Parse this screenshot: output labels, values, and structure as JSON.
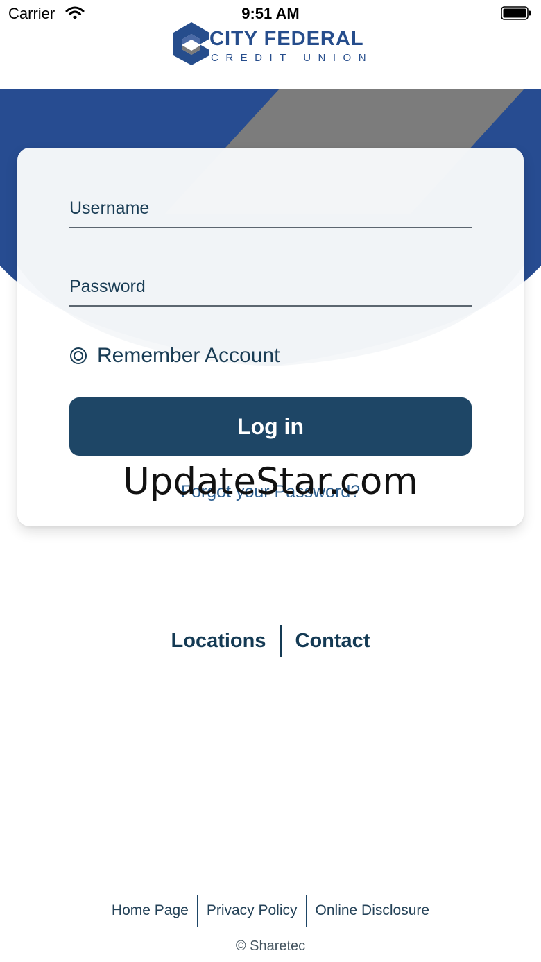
{
  "status_bar": {
    "carrier": "Carrier",
    "time": "9:51 AM",
    "wifi_icon": "wifi-icon",
    "battery_icon": "battery-icon"
  },
  "brand": {
    "name_line1": "CITY FEDERAL",
    "name_line2": "CREDIT UNION",
    "logo_icon": "cfcu-hexagon-logo",
    "colors": {
      "navy": "#264d8c",
      "gray": "#7a7a7a",
      "band_blue": "#274c91",
      "button": "#1e4666"
    }
  },
  "login": {
    "username_placeholder": "Username",
    "password_placeholder": "Password",
    "username_value": "",
    "password_value": "",
    "remember_label": "Remember Account",
    "remember_icon": "radio-unchecked-icon",
    "login_button": "Log in",
    "forgot_password": "Forgot your Password?"
  },
  "watermark": "UpdateStar.com",
  "quick_links": {
    "locations": "Locations",
    "contact": "Contact"
  },
  "footer": {
    "home_page": "Home Page",
    "privacy_policy": "Privacy Policy",
    "online_disclosure": "Online Disclosure",
    "copyright": "© Sharetec"
  }
}
